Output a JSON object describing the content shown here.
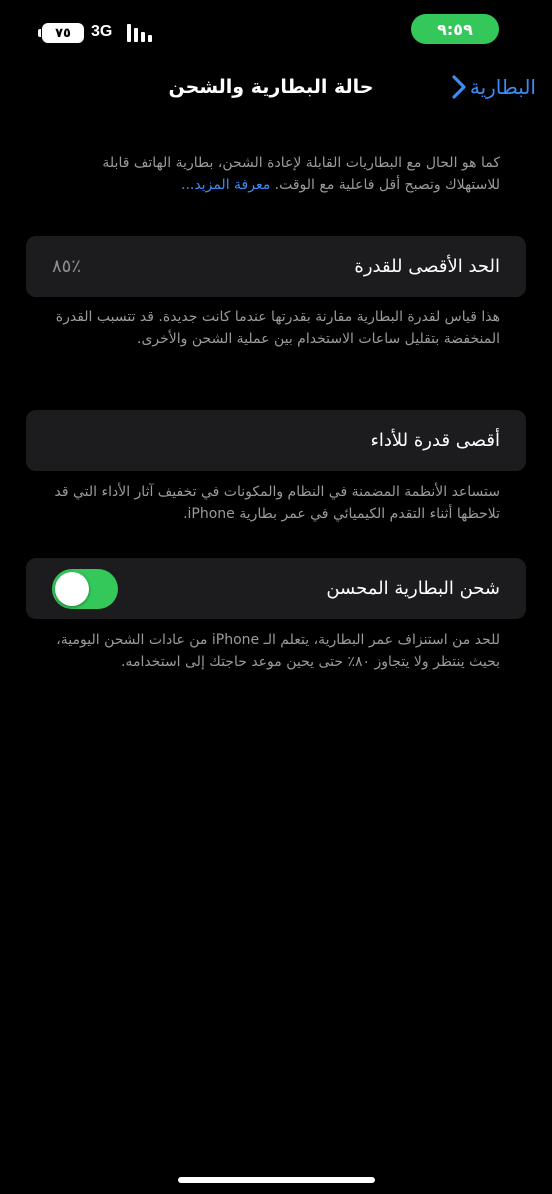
{
  "status_bar": {
    "battery_level": "٧٥",
    "network": "3G",
    "signal_bars": 4,
    "time": "٩:٥٩",
    "time_pill_color": "#34c759"
  },
  "nav": {
    "back_label": "البطارية",
    "title": "حالة البطارية والشحن",
    "accent_color": "#3b8cf5",
    "back_icon": "chevron-right-icon"
  },
  "intro": {
    "text": "كما هو الحال مع البطاريات القابلة لإعادة الشحن، بطارية الهاتف قابلة للاستهلاك وتصبح أقل فاعلية مع الوقت.",
    "learn_more": "معرفة المزيد..."
  },
  "max_capacity": {
    "label": "الحد الأقصى للقدرة",
    "value": "٪٨٥",
    "description": "هذا قياس لقدرة البطارية مقارنة بقدرتها عندما كانت جديدة. قد تتسبب القدرة المنخفضة بتقليل ساعات الاستخدام بين عملية الشحن والأخرى."
  },
  "peak_performance": {
    "label": "أقصى قدرة للأداء",
    "description": "ستساعد الأنظمة المضمنة في النظام والمكونات في تخفيف آثار الأداء التي قد تلاحظها أثناء التقدم الكيميائي في عمر بطارية iPhone."
  },
  "optimized_charging": {
    "label": "شحن البطارية المحسن",
    "enabled": true,
    "toggle_color": "#34c759",
    "description": "للحد من استنزاف عمر البطارية، يتعلم الـ iPhone من عادات الشحن اليومية، بحيث ينتظر ولا يتجاوز ٨٠٪ حتى يحين موعد حاجتك إلى استخدامه."
  }
}
